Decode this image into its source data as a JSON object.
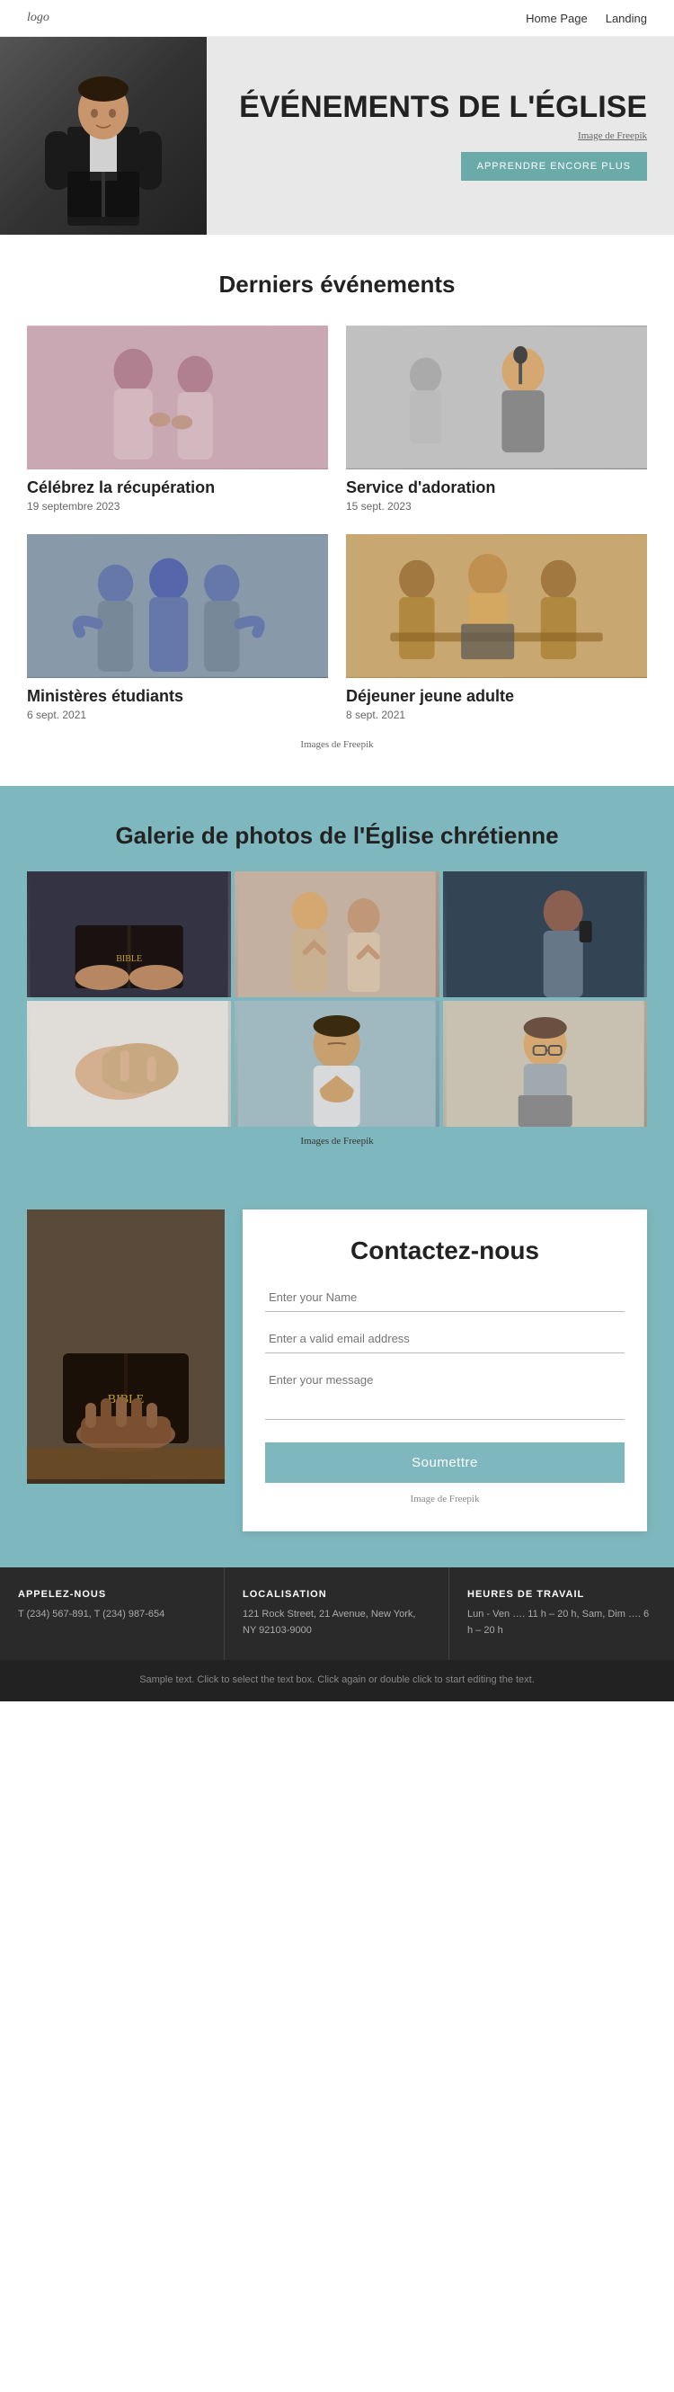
{
  "nav": {
    "logo": "logo",
    "links": [
      {
        "label": "Home Page",
        "href": "#"
      },
      {
        "label": "Landing",
        "href": "#"
      }
    ]
  },
  "hero": {
    "title": "ÉVÉNEMENTS DE L'ÉGLISE",
    "source_label": "Image de Freepik",
    "button_label": "APPRENDRE ENCORE PLUS"
  },
  "events": {
    "section_title": "Derniers événements",
    "items": [
      {
        "name": "Célébrez la récupération",
        "date": "19 septembre 2023"
      },
      {
        "name": "Service d'adoration",
        "date": "15 sept. 2023"
      },
      {
        "name": "Ministères étudiants",
        "date": "6 sept. 2021"
      },
      {
        "name": "Déjeuner jeune adulte",
        "date": "8 sept. 2021"
      }
    ],
    "freepik_note": "Images de Freepik"
  },
  "gallery": {
    "title": "Galerie de photos de l'Église chrétienne",
    "freepik_note": "Images de Freepik"
  },
  "contact": {
    "title": "Contactez-nous",
    "name_placeholder": "Enter your Name",
    "email_placeholder": "Enter a valid email address",
    "message_placeholder": "Enter your message",
    "submit_label": "Soumettre",
    "image_note": "Image de Freepik"
  },
  "footer": {
    "cols": [
      {
        "title": "APPELEZ-NOUS",
        "text": "T (234) 567-891, T (234) 987-654"
      },
      {
        "title": "LOCALISATION",
        "text": "121 Rock Street, 21 Avenue, New York, NY 92103-9000"
      },
      {
        "title": "HEURES DE TRAVAIL",
        "text": "Lun - Ven …. 11 h – 20 h, Sam, Dim …. 6 h – 20 h"
      }
    ],
    "sample_text": "Sample text. Click to select the text box. Click again or double click to start editing the text."
  }
}
